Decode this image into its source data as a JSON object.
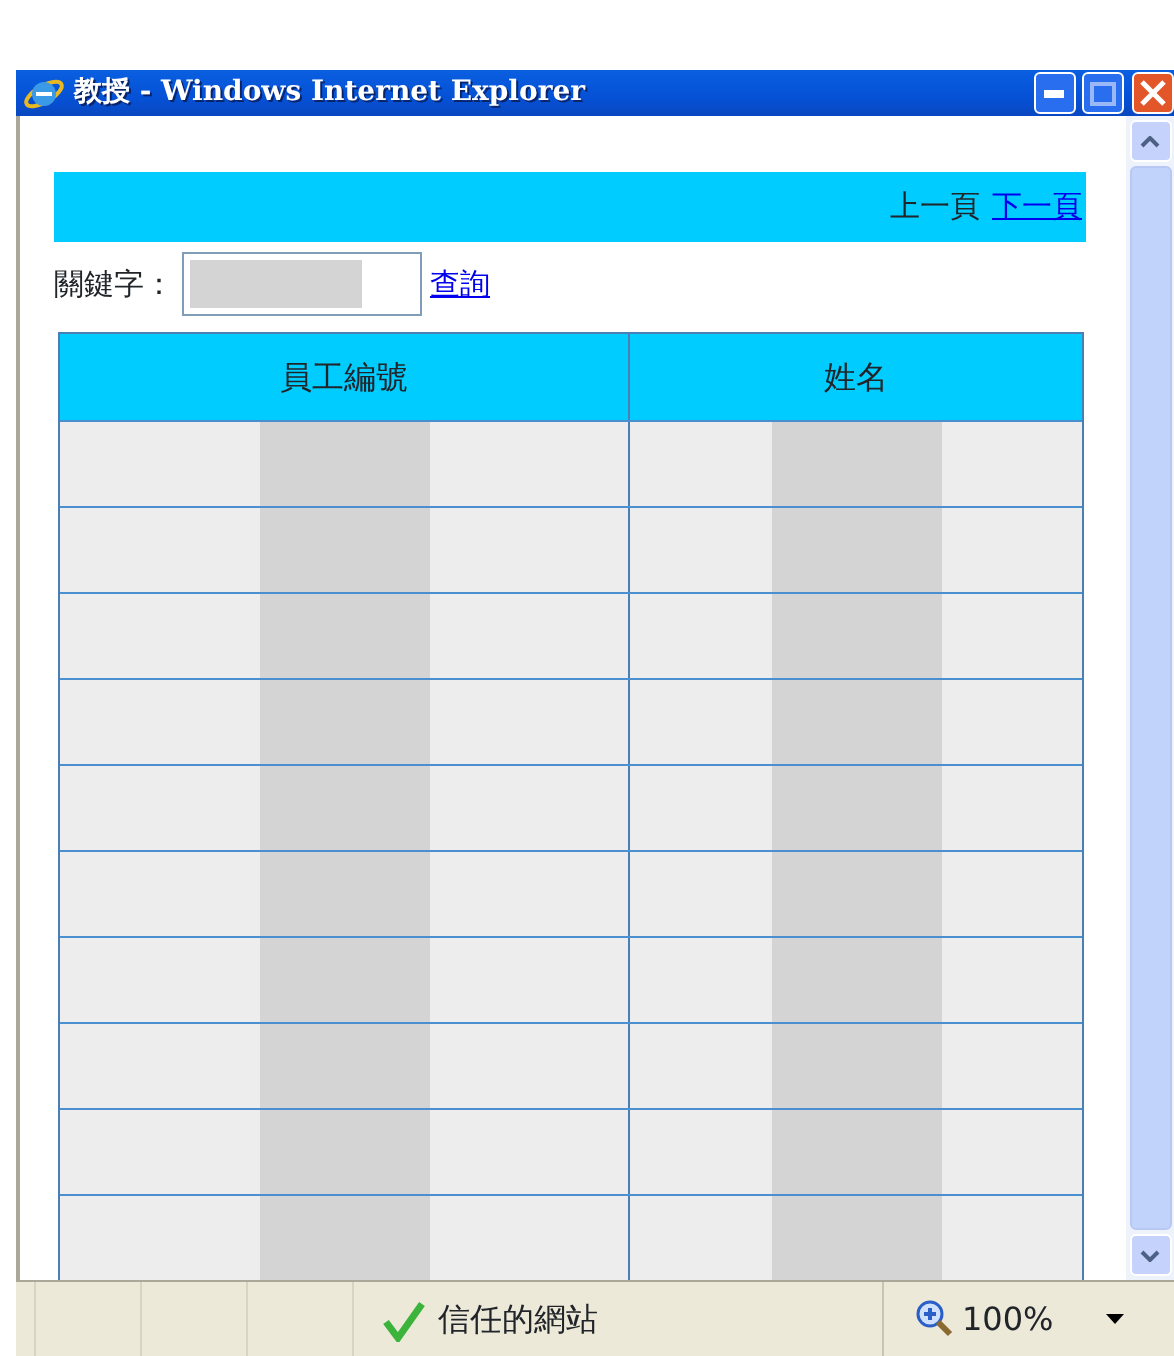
{
  "window": {
    "title": "教授 - Windows Internet Explorer"
  },
  "pager": {
    "prev": "上一頁",
    "next": "下一頁"
  },
  "search": {
    "label": "關鍵字：",
    "value_redacted": true,
    "button": "查詢"
  },
  "table": {
    "columns": [
      "員工編號",
      "姓名"
    ],
    "rows": [
      {
        "kind": "redacted"
      },
      {
        "kind": "redacted"
      },
      {
        "kind": "redacted"
      },
      {
        "kind": "redacted"
      },
      {
        "kind": "redacted"
      },
      {
        "kind": "redacted"
      },
      {
        "kind": "redacted"
      },
      {
        "kind": "redacted"
      },
      {
        "kind": "redacted"
      },
      {
        "kind": "redacted"
      }
    ]
  },
  "status_bar": {
    "zone": "信任的網站",
    "zoom": "100%"
  }
}
